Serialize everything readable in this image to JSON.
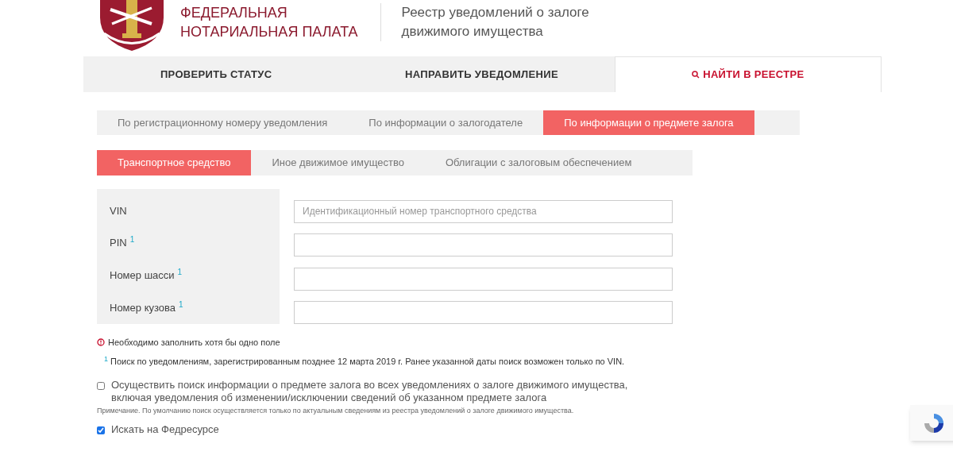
{
  "header": {
    "org_name": [
      "ФЕДЕРАЛЬНАЯ",
      "НОТАРИАЛЬНАЯ ПАЛАТА"
    ],
    "registry_title": [
      "Реестр уведомлений о залоге",
      "движимого имущества"
    ]
  },
  "main_tabs": [
    {
      "label": "ПРОВЕРИТЬ СТАТУС",
      "selected": false
    },
    {
      "label": "НАПРАВИТЬ УВЕДОМЛЕНИЕ",
      "selected": false
    },
    {
      "label": "НАЙТИ В РЕЕСТРЕ",
      "selected": true
    }
  ],
  "search_tabs": [
    {
      "label": "По регистрационному номеру уведомления",
      "selected": false
    },
    {
      "label": "По информации о залогодателе",
      "selected": false
    },
    {
      "label": "По информации о предмете залога",
      "selected": true
    }
  ],
  "property_tabs": [
    {
      "label": "Транспортное средство",
      "selected": true
    },
    {
      "label": "Иное движимое имущество",
      "selected": false
    },
    {
      "label": "Облигации с залоговым обеспечением",
      "selected": false
    }
  ],
  "fields": [
    {
      "label": "VIN",
      "placeholder": "Идентификационный номер транспортного средства"
    },
    {
      "label": "PIN",
      "footnote": "1"
    },
    {
      "label": "Номер шасси",
      "footnote": "1"
    },
    {
      "label": "Номер кузова",
      "footnote": "1"
    }
  ],
  "required_notice": "Необходимо заполнить хотя бы одно поле",
  "footnote": {
    "mark": "1",
    "text": "Поиск по уведомлениям, зарегистрированным позднее 12 марта 2019 г. Ранее указанной даты поиск возможен только по VIN."
  },
  "options": [
    {
      "label": "Осуществить поиск информации о предмете залога во всех уведомлениях о залоге движимого имущества, включая уведомления об изменении/исключении сведений об указанном предмете залога",
      "checked": false,
      "note": "Примечание. По умолчанию поиск осуществляется только по актуальным сведениям из реестра уведомлений о залоге движимого имущества."
    },
    {
      "label": "Искать на Федресурсе",
      "checked": true
    }
  ]
}
